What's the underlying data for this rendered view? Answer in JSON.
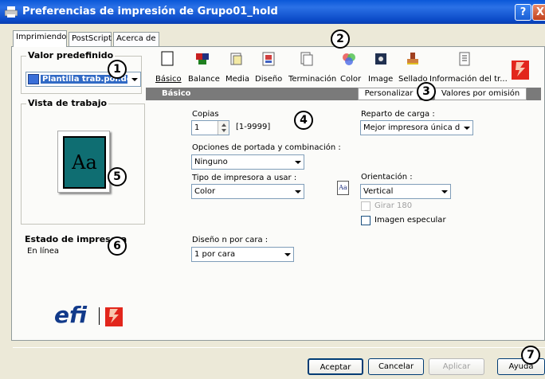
{
  "window": {
    "title": "Preferencias de impresión de Grupo01_hold",
    "help": "?",
    "close": "X"
  },
  "tabs": [
    "Imprimiendo",
    "PostScript",
    "Acerca de"
  ],
  "left": {
    "valor_label": "Valor predefinido",
    "valor_value": "Plantilla trab.por.def",
    "vista_label": "Vista de trabajo",
    "preview_text": "Aa",
    "estado_label": "Estado de impresora",
    "estado_value": "En línea",
    "logo_efi": "efi",
    "logo_fiery": "fiery"
  },
  "toolbar": [
    "Básico",
    "Balance",
    "Media",
    "Diseño",
    "Terminación",
    "Color",
    "Image",
    "Sellado",
    "Información del tr..."
  ],
  "header": {
    "section": "Básico",
    "personalize": "Personalizar",
    "defaults": "Valores por omisión"
  },
  "form": {
    "copias_label": "Copias",
    "copias_value": "1",
    "copias_range": "[1-9999]",
    "portada_label": "Opciones de portada y combinación :",
    "portada_value": "Ninguno",
    "tipo_label": "Tipo de impresora a usar :",
    "tipo_value": "Color",
    "diseno_label": "Diseño n por cara :",
    "diseno_value": "1 por cara",
    "reparto_label": "Reparto de carga :",
    "reparto_value": "Mejor impresora única disp",
    "orient_icon": "Aa",
    "orient_label": "Orientación :",
    "orient_value": "Vertical",
    "girar_label": "Girar 180",
    "espejo_label": "Imagen especular"
  },
  "buttons": {
    "ok": "Aceptar",
    "cancel": "Cancelar",
    "apply": "Aplicar",
    "help": "Ayuda"
  },
  "badges": [
    "1",
    "2",
    "3",
    "4",
    "5",
    "6",
    "7"
  ]
}
